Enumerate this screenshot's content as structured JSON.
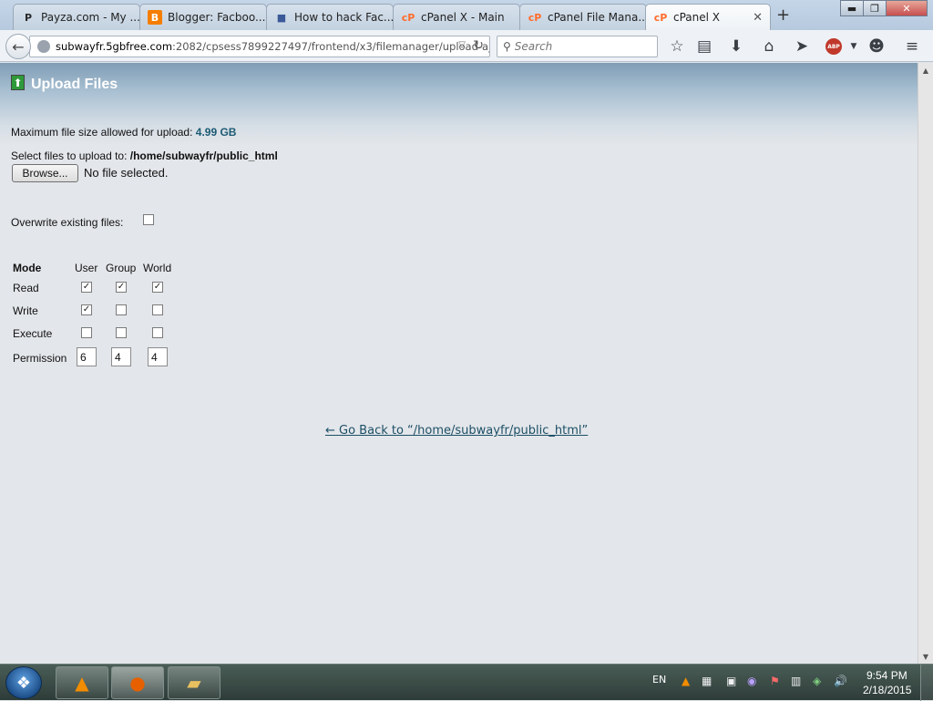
{
  "browser": {
    "tabs": [
      {
        "label": "Payza.com - My ...",
        "favicon": "P",
        "favicon_color": "#2a2a2a"
      },
      {
        "label": "Blogger: Facboo...",
        "favicon": "B",
        "favicon_color": "#f57d00"
      },
      {
        "label": "How to hack Fac...",
        "favicon": "■",
        "favicon_color": "#3b5998"
      },
      {
        "label": "cPanel X - Main",
        "favicon": "cP",
        "favicon_color": "#ff6c2c"
      },
      {
        "label": "cPanel File Mana...",
        "favicon": "cP",
        "favicon_color": "#ff6c2c"
      },
      {
        "label": "cPanel X",
        "favicon": "cP",
        "favicon_color": "#ff6c2c"
      }
    ],
    "active_tab": 5,
    "url_host": "subwayfr.5gbfree.com",
    "url_rest": ":2082/cpsess7899227497/frontend/x3/filemanager/upload-aja",
    "search_placeholder": "Search",
    "window_buttons": {
      "minimize": "▬",
      "maximize": "❐",
      "close": "✕"
    }
  },
  "page": {
    "title": "Upload Files",
    "max_size_label": "Maximum file size allowed for upload:",
    "max_size_value": "4.99 GB",
    "select_label": "Select files to upload to:",
    "select_path": "/home/subwayfr/public_html",
    "browse_button": "Browse...",
    "no_file": "No file selected.",
    "overwrite_label": "Overwrite existing files:",
    "overwrite_checked": false,
    "permissions": {
      "header": "Mode",
      "columns": [
        "User",
        "Group",
        "World"
      ],
      "rows": [
        {
          "label": "Read",
          "checked": [
            true,
            true,
            true
          ]
        },
        {
          "label": "Write",
          "checked": [
            true,
            false,
            false
          ]
        },
        {
          "label": "Execute",
          "checked": [
            false,
            false,
            false
          ]
        }
      ],
      "permission_label": "Permission",
      "permission_values": [
        "6",
        "4",
        "4"
      ]
    },
    "go_back_link": "← Go Back to “/home/subwayfr/public_html”"
  },
  "taskbar": {
    "language": "EN",
    "time": "9:54 PM",
    "date": "2/18/2015"
  }
}
